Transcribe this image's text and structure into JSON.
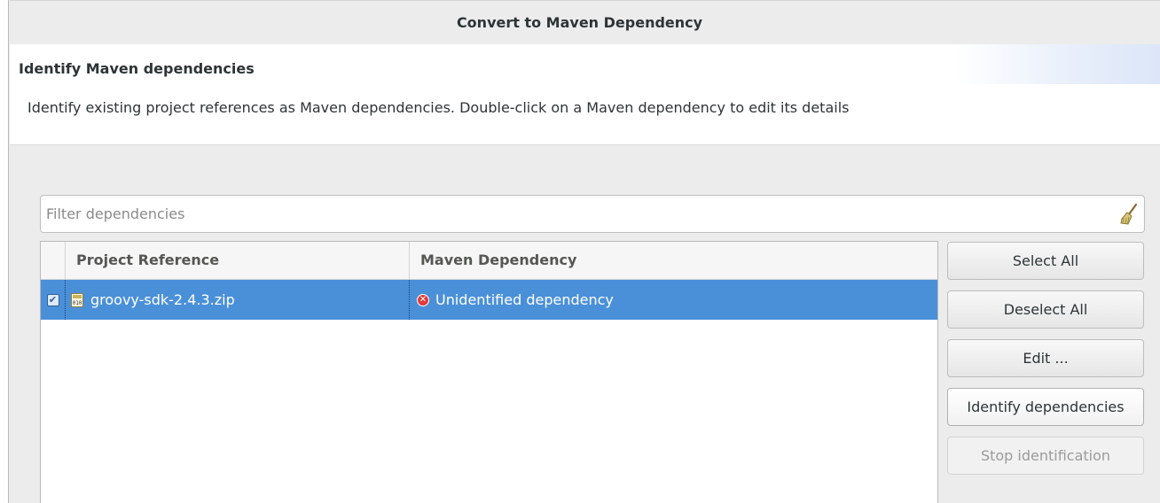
{
  "dialog": {
    "title": "Convert to Maven Dependency"
  },
  "banner": {
    "title": "Identify Maven dependencies",
    "description": "Identify existing project references as Maven dependencies. Double-click on a Maven dependency to edit its details"
  },
  "filter": {
    "value": "",
    "placeholder": "Filter dependencies",
    "clear_icon": "broom-icon"
  },
  "table": {
    "columns": [
      "Project Reference",
      "Maven Dependency"
    ],
    "rows": [
      {
        "checked": true,
        "project_reference": "groovy-sdk-2.4.3.zip",
        "project_reference_icon": "zip-archive-icon",
        "maven_dependency": "Unidentified dependency",
        "maven_dependency_icon": "error-icon",
        "selected": true
      }
    ]
  },
  "buttons": {
    "select_all": "Select All",
    "deselect_all": "Deselect All",
    "edit": "Edit ...",
    "identify": "Identify dependencies",
    "stop": "Stop identification"
  },
  "colors": {
    "selection": "#4a90d9",
    "error": "#e03a3a",
    "disabled_text": "#9b9b9b"
  }
}
